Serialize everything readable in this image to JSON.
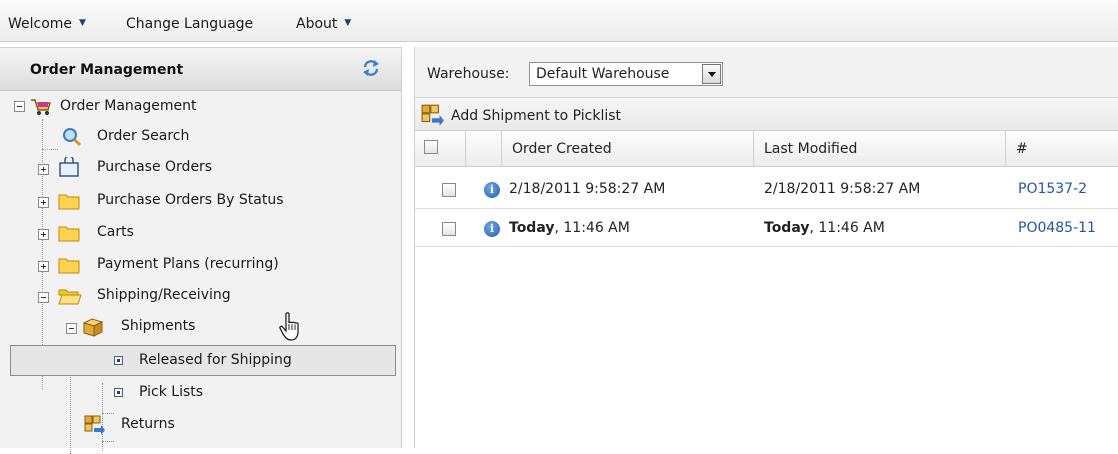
{
  "menu": {
    "welcome": "Welcome",
    "change_language": "Change Language",
    "about": "About"
  },
  "left_panel": {
    "title": "Order Management",
    "tree": {
      "root": "Order Management",
      "order_search": "Order Search",
      "purchase_orders": "Purchase Orders",
      "purchase_orders_by_status": "Purchase Orders By Status",
      "carts": "Carts",
      "payment_plans": "Payment Plans (recurring)",
      "shipping_receiving": "Shipping/Receiving",
      "shipments": "Shipments",
      "released_for_shipping": "Released for Shipping",
      "pick_lists": "Pick Lists",
      "returns": "Returns"
    }
  },
  "right_panel": {
    "warehouse_label": "Warehouse:",
    "warehouse_value": "Default Warehouse",
    "toolbar": {
      "add_shipment": "Add Shipment to Picklist"
    },
    "columns": {
      "order_created": "Order Created",
      "last_modified": "Last Modified",
      "number": "#"
    },
    "rows": [
      {
        "created_bold": "",
        "created": "2/18/2011 9:58:27 AM",
        "modified_bold": "",
        "modified": "2/18/2011 9:58:27 AM",
        "number": "PO1537-2"
      },
      {
        "created_bold": "Today",
        "created": ", 11:46 AM",
        "modified_bold": "Today",
        "modified": ", 11:46 AM",
        "number": "PO0485-11"
      }
    ]
  },
  "colors": {
    "link": "#1f56a8",
    "menu_caret": "#1f3f7f",
    "selected_border": "#8c8c8c"
  }
}
